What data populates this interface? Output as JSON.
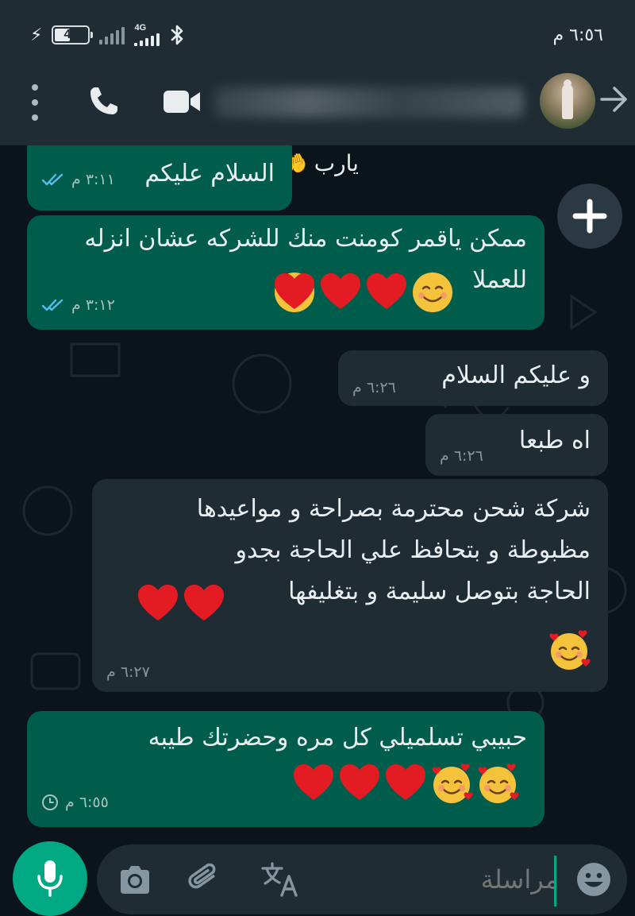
{
  "status_bar": {
    "time": "٦:٥٦ م",
    "battery": "42",
    "battery_level": 0.42,
    "network": "4G",
    "icons": [
      "charging-bolt-icon",
      "battery-icon",
      "signal-icon",
      "bluetooth-icon"
    ]
  },
  "header": {
    "contact_name": "████ █████ ████",
    "icons": [
      "more-options-icon",
      "phone-call-icon",
      "video-call-icon",
      "avatar",
      "back-arrow-icon"
    ]
  },
  "chat": {
    "quoted_reply": "يارب 🤲",
    "messages": [
      {
        "direction": "out",
        "text": "السلام عليكم",
        "time": "٣:١١ م",
        "status": "read"
      },
      {
        "direction": "out",
        "text": "ممكن ياقمر كومنت منك للشركه عشان انزله\nللعملا",
        "emoji": [
          "smiling-face",
          "red-heart",
          "red-heart",
          "red-heart"
        ],
        "time": "٣:١٢ م",
        "status": "read"
      },
      {
        "direction": "in",
        "text": "و عليكم السلام",
        "time": "٦:٢٦ م"
      },
      {
        "direction": "in",
        "text": "اه طبعا",
        "time": "٦:٢٦ م"
      },
      {
        "direction": "in",
        "text": "شركة شحن محترمة بصراحة و مواعيدها\nمظبوطة  و بتحافظ علي الحاجة بجدو\nالحاجة بتوصل سليمة و بتغليفها",
        "emoji": [
          "red-heart",
          "red-heart",
          "smiling-face-with-hearts"
        ],
        "time": "٦:٢٧ م"
      },
      {
        "direction": "out",
        "text": "حبيبي تسلميلي كل مره وحضرتك طيبه",
        "emoji": [
          "smiling-face-with-hearts",
          "smiling-face-with-hearts",
          "red-heart",
          "red-heart",
          "red-heart"
        ],
        "time": "٦:٥٥ م",
        "status": "pending"
      }
    ]
  },
  "input": {
    "placeholder": "مراسلة",
    "icons": [
      "microphone-icon",
      "camera-icon",
      "attach-icon",
      "translate-icon",
      "emoji-icon"
    ]
  },
  "colors": {
    "header_bg": "#1f2c34",
    "chat_bg": "#0b141a",
    "outgoing_bubble": "#005c4b",
    "incoming_bubble": "#1f2c34",
    "accent": "#00a884",
    "read_tick": "#53bdeb"
  }
}
